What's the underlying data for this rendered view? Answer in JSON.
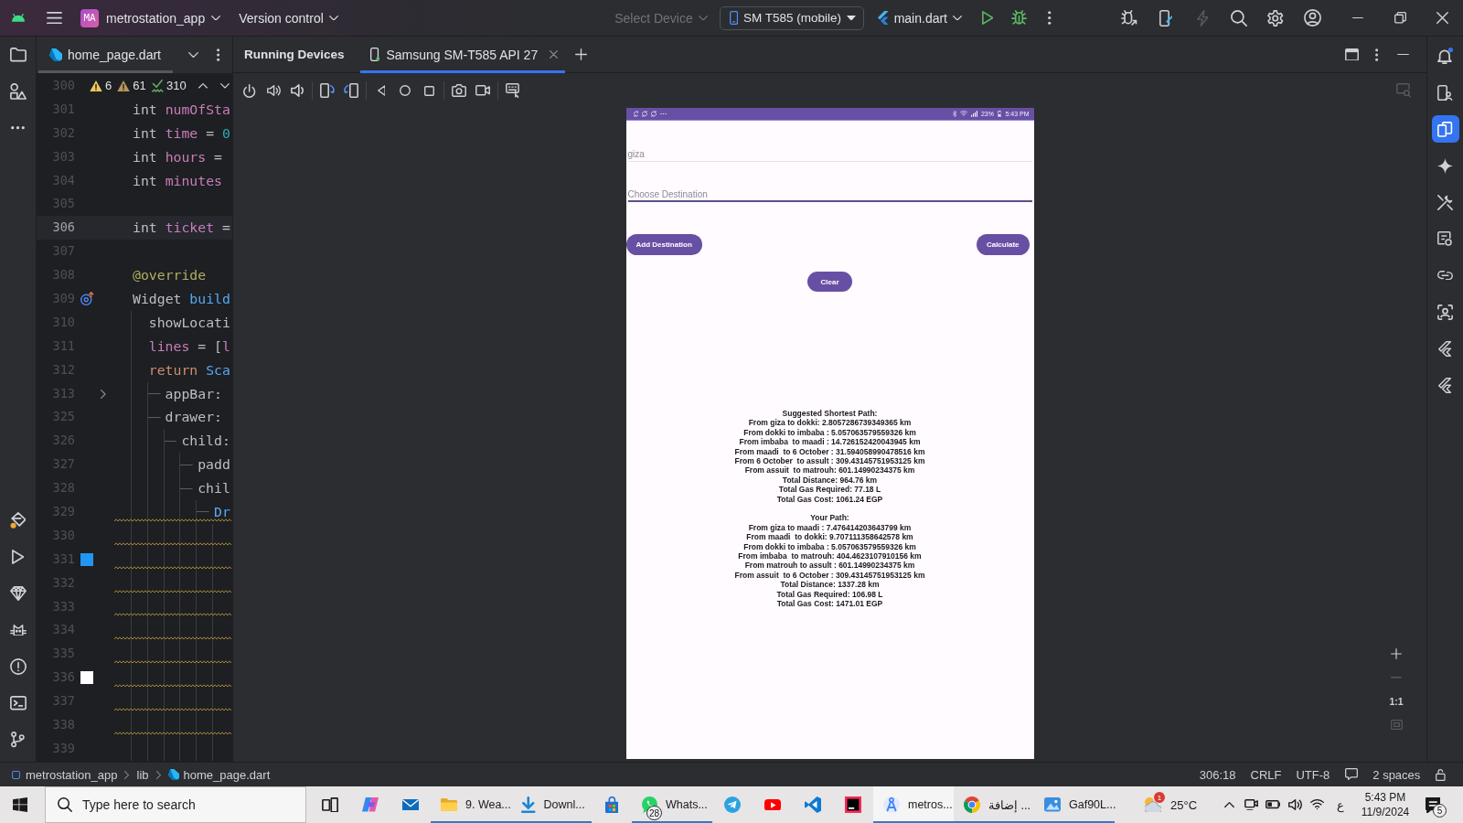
{
  "title_bar": {
    "project_badge": "MA",
    "project": "metrostation_app",
    "vcs": "Version control",
    "device_selector": {
      "label": "Select Device",
      "disabled": true
    },
    "device": "SM T585 (mobile)",
    "run_config": "main.dart",
    "actions": [
      {
        "kind": "attach-debugger",
        "disabled": false
      },
      {
        "kind": "device-mirror",
        "disabled": false
      },
      {
        "kind": "hot-reload",
        "disabled": true
      },
      {
        "kind": "search",
        "disabled": false
      },
      {
        "kind": "settings",
        "disabled": false
      },
      {
        "kind": "account",
        "disabled": false
      }
    ]
  },
  "editor": {
    "tabs": [
      {
        "label": "home_page.dart",
        "selected": true
      }
    ],
    "inspections": [
      {
        "kind": "warning",
        "count": "6"
      },
      {
        "kind": "weak-warning",
        "count": "61"
      },
      {
        "kind": "typo",
        "count": "310"
      }
    ],
    "lines": [
      {
        "number": "300",
        "current": false,
        "warning": false
      },
      {
        "number": "301",
        "current": false,
        "warning": false,
        "tokens": [
          {
            "kind": "plain",
            "text": "int "
          },
          {
            "kind": "field",
            "text": "numOfSta"
          }
        ]
      },
      {
        "number": "302",
        "current": false,
        "warning": false,
        "tokens": [
          {
            "kind": "plain",
            "text": "int "
          },
          {
            "kind": "field",
            "text": "time"
          },
          {
            "kind": "plain",
            "text": " = "
          },
          {
            "kind": "number",
            "text": "0"
          }
        ]
      },
      {
        "number": "303",
        "current": false,
        "warning": false,
        "tokens": [
          {
            "kind": "plain",
            "text": "int "
          },
          {
            "kind": "field",
            "text": "hours"
          },
          {
            "kind": "plain",
            "text": " ="
          }
        ]
      },
      {
        "number": "304",
        "current": false,
        "warning": false,
        "tokens": [
          {
            "kind": "plain",
            "text": "int "
          },
          {
            "kind": "field",
            "text": "minutes"
          }
        ]
      },
      {
        "number": "305",
        "current": false,
        "warning": false
      },
      {
        "number": "306",
        "current": true,
        "warning": false,
        "tokens": [
          {
            "kind": "plain",
            "text": "int "
          },
          {
            "kind": "field",
            "text": "ticket"
          },
          {
            "kind": "plain",
            "text": " ="
          }
        ]
      },
      {
        "number": "307",
        "current": false,
        "warning": false
      },
      {
        "number": "308",
        "current": false,
        "warning": false,
        "tokens": [
          {
            "kind": "annotation",
            "text": "@override"
          }
        ]
      },
      {
        "number": "309",
        "current": false,
        "warning": false,
        "gutter": {
          "kind": "override"
        },
        "tokens": [
          {
            "kind": "plain",
            "text": "Widget "
          },
          {
            "kind": "function",
            "text": "build"
          }
        ],
        "children": [
          {
            "number": "310",
            "current": false,
            "warning": false,
            "tokens": [
              {
                "kind": "plain",
                "text": "showLocati"
              }
            ]
          },
          {
            "number": "311",
            "current": false,
            "warning": false,
            "tokens": [
              {
                "kind": "field",
                "text": "lines"
              },
              {
                "kind": "plain",
                "text": " = ["
              },
              {
                "kind": "field",
                "text": "l"
              }
            ]
          },
          {
            "number": "312",
            "current": false,
            "warning": false,
            "tokens": [
              {
                "kind": "keyword",
                "text": "return "
              },
              {
                "kind": "function",
                "text": "Sca"
              }
            ],
            "children": [
              {
                "number": "313",
                "current": false,
                "warning": false,
                "gutter": {
                  "kind": "fold"
                },
                "tokens": [
                  {
                    "kind": "plain",
                    "text": "appBar:"
                  }
                ]
              },
              {
                "number": "325",
                "current": false,
                "warning": false,
                "tokens": [
                  {
                    "kind": "plain",
                    "text": "drawer:"
                  }
                ],
                "children": [
                  {
                    "number": "326",
                    "current": false,
                    "warning": false,
                    "tokens": [
                      {
                        "kind": "plain",
                        "text": "child:"
                      }
                    ],
                    "children": [
                      {
                        "number": "327",
                        "current": false,
                        "warning": false,
                        "tokens": [
                          {
                            "kind": "plain",
                            "text": "padd"
                          }
                        ]
                      },
                      {
                        "number": "328",
                        "current": false,
                        "warning": false,
                        "tokens": [
                          {
                            "kind": "plain",
                            "text": "chil"
                          }
                        ],
                        "children": [
                          {
                            "number": "329",
                            "current": false,
                            "warning": true,
                            "tokens": [
                              {
                                "kind": "function",
                                "text": "Dr"
                              }
                            ],
                            "children": [
                              {
                                "number": "330",
                                "current": false,
                                "warning": true
                              },
                              {
                                "number": "331",
                                "current": false,
                                "warning": true,
                                "gutter": {
                                  "kind": "swatch",
                                  "color": "#2196f3"
                                }
                              },
                              {
                                "number": "332",
                                "current": false,
                                "warning": true
                              },
                              {
                                "number": "333",
                                "current": false,
                                "warning": true
                              },
                              {
                                "number": "334",
                                "current": false,
                                "warning": true
                              },
                              {
                                "number": "335",
                                "current": false,
                                "warning": true
                              },
                              {
                                "number": "336",
                                "current": false,
                                "warning": true,
                                "gutter": {
                                  "kind": "swatch",
                                  "color": "#ffffff"
                                }
                              },
                              {
                                "number": "337",
                                "current": false,
                                "warning": true
                              },
                              {
                                "number": "338",
                                "current": false,
                                "warning": true
                              },
                              {
                                "number": "339",
                                "current": false,
                                "warning": false
                              }
                            ]
                          }
                        ]
                      }
                    ]
                  }
                ]
              }
            ]
          }
        ]
      }
    ]
  },
  "running_devices": {
    "title": "Running Devices",
    "tabs": [
      {
        "label": "Samsung SM-T585 API 27",
        "selected": true
      }
    ],
    "zoom_controls": [
      {
        "kind": "zoom-in",
        "disabled": false
      },
      {
        "kind": "zoom-out",
        "disabled": true
      },
      {
        "kind": "actual-size",
        "label": "1:1",
        "disabled": false
      },
      {
        "kind": "fit-screen",
        "disabled": true
      }
    ]
  },
  "phone": {
    "status_bar": {
      "battery": "23%",
      "time": "5:43 PM"
    },
    "fields": [
      {
        "placeholder": "giza",
        "focused": false
      },
      {
        "placeholder": "Choose Destination",
        "focused": true
      }
    ],
    "action_buttons": [
      "Add Destination",
      "Calculate"
    ],
    "clear_button": "Clear",
    "results": [
      {
        "title": "Suggested Shortest Path:",
        "lines": [
          "From giza to dokki: 2.8057286739349365 km",
          "From dokki to imbaba : 5.057063579559326 km",
          "From imbaba  to maadi : 14.726152420043945 km",
          "From maadi  to 6 October : 31.594058990478516 km",
          "From 6 October  to assult : 309.43145751953125 km",
          "From assuit  to matrouh: 601.14990234375 km",
          "Total Distance: 964.76 km",
          "Total Gas Required: 77.18 L",
          "Total Gas Cost: 1061.24 EGP"
        ]
      },
      {
        "title": "Your Path:",
        "lines": [
          "From giza to maadi : 7.476414203643799 km",
          "From maadi  to dokki: 9.707111358642578 km",
          "From dokki to imbaba : 5.057063579559326 km",
          "From imbaba  to matrouh: 404.4623107910156 km",
          "From matrouh to assult : 601.14990234375 km",
          "From assuit  to 6 October : 309.43145751953125 km",
          "Total Distance: 1337.28 km",
          "Total Gas Required: 106.98 L",
          "Total Gas Cost: 1471.01 EGP"
        ]
      }
    ]
  },
  "right_toolbar": {
    "notifications": {
      "unread": true
    },
    "items": [
      {
        "kind": "device-manager",
        "selected": false
      },
      {
        "kind": "running-devices",
        "selected": true
      },
      {
        "kind": "gemini",
        "selected": false
      },
      {
        "kind": "tools",
        "selected": false
      },
      {
        "kind": "app-inspection",
        "selected": false
      },
      {
        "kind": "connection",
        "selected": false
      },
      {
        "kind": "layout-inspector",
        "selected": false
      },
      {
        "kind": "flutter-inspector",
        "selected": false
      },
      {
        "kind": "flutter-outline",
        "selected": false
      }
    ]
  },
  "status_bar": {
    "breadcrumbs": [
      "metrostation_app",
      "lib",
      "home_page.dart"
    ],
    "position": "306:18",
    "line_separator": "CRLF",
    "encoding": "UTF-8",
    "indent": "2 spaces"
  },
  "taskbar": {
    "search_placeholder": "Type here to search",
    "apps": [
      {
        "kind": "task-view",
        "running": false,
        "selected": false
      },
      {
        "kind": "copilot",
        "running": false,
        "selected": false
      },
      {
        "kind": "mail",
        "running": false,
        "selected": false
      },
      {
        "kind": "file-explorer",
        "label": "9. Wea...",
        "running": true,
        "selected": false
      },
      {
        "kind": "downloads",
        "label": "Downl...",
        "running": true,
        "selected": false
      },
      {
        "kind": "store",
        "running": false,
        "selected": false
      },
      {
        "kind": "whatsapp",
        "label": "Whats...",
        "badge": "28",
        "running": true,
        "selected": false
      },
      {
        "kind": "telegram",
        "running": false,
        "selected": false
      },
      {
        "kind": "youtube",
        "running": false,
        "selected": false
      },
      {
        "kind": "vscode",
        "running": false,
        "selected": false
      },
      {
        "kind": "jetbrains",
        "running": false,
        "selected": false
      },
      {
        "kind": "android-studio",
        "label": "metros...",
        "running": true,
        "selected": true
      },
      {
        "kind": "chrome",
        "label": "إضافة ...",
        "running": true,
        "selected": false
      },
      {
        "kind": "photos",
        "label": "Gaf90L...",
        "running": true,
        "selected": false
      }
    ],
    "weather": {
      "temperature": "25°C",
      "badge": "1"
    },
    "input_language": "ع",
    "time": "5:43 PM",
    "date": "11/9/2024",
    "notification_count": "5"
  }
}
